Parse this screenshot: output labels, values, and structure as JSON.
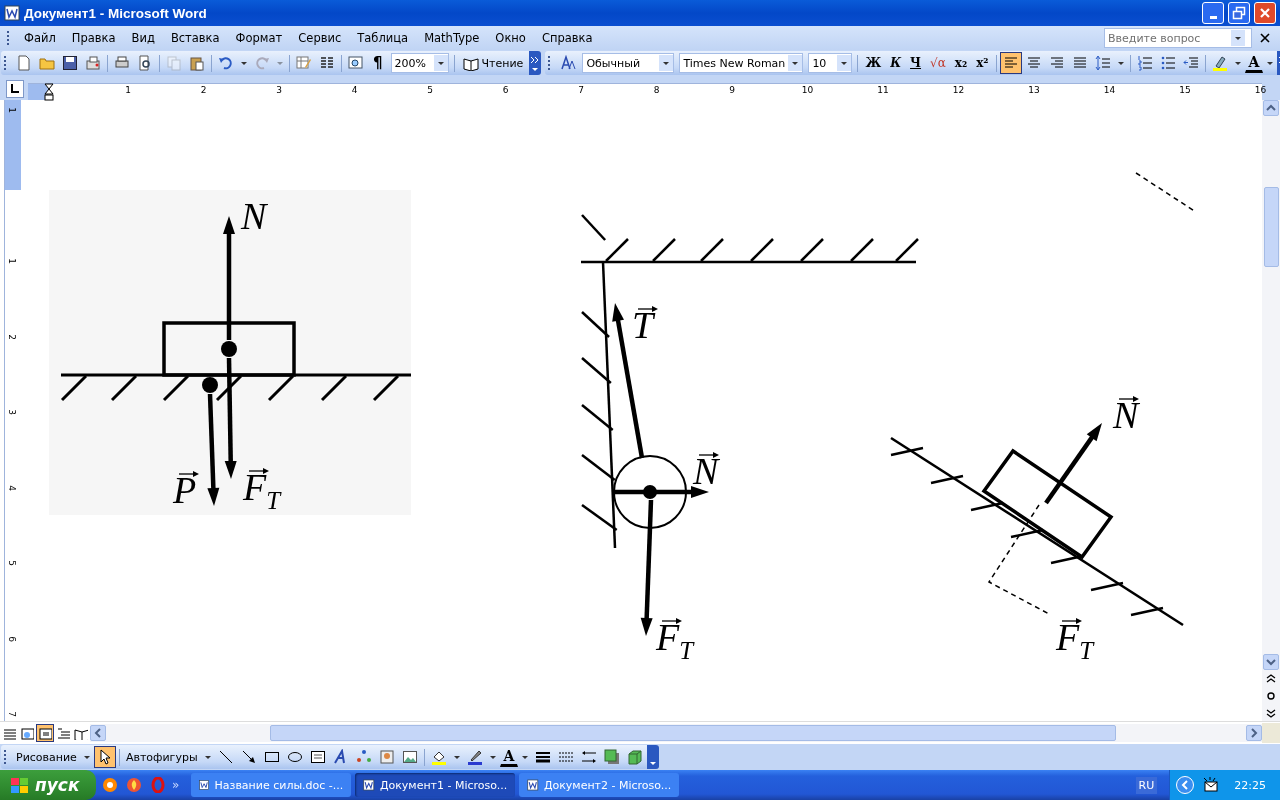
{
  "window": {
    "title": "Документ1 - Microsoft Word"
  },
  "menu": [
    "Файл",
    "Правка",
    "Вид",
    "Вставка",
    "Формат",
    "Сервис",
    "Таблица",
    "MathType",
    "Окно",
    "Справка"
  ],
  "help_box": {
    "placeholder": "Введите вопрос"
  },
  "standard_toolbar": {
    "pilcrow": "¶",
    "zoom": "200%",
    "reading": "Чтение"
  },
  "formatting_toolbar": {
    "style": "Обычный",
    "font": "Times New Roman",
    "size": "10",
    "text_buttons": [
      "Ж",
      "К",
      "Ч",
      "√α",
      "x₂",
      "x²"
    ],
    "font_color": "A",
    "align_buttons": [
      {
        "selected": true
      },
      {
        "selected": false
      },
      {
        "selected": false
      },
      {
        "selected": false
      }
    ]
  },
  "ruler": {
    "numbers": [
      "1",
      "2",
      "3",
      "4",
      "5",
      "6",
      "7",
      "8",
      "9",
      "10",
      "11",
      "12",
      "13",
      "14",
      "15",
      "16"
    ]
  },
  "vertical_ruler": {
    "numbers": [
      "1",
      "1",
      "2",
      "3",
      "4",
      "5",
      "6",
      "7"
    ]
  },
  "diagrams": [
    {
      "kind": "block-on-floor",
      "labels": [
        {
          "letter": "N",
          "vector": false
        },
        {
          "letter": "P",
          "vector": true
        },
        {
          "letter": "F",
          "subscript": "T",
          "vector": true
        }
      ]
    },
    {
      "kind": "ball-on-wall",
      "labels": [
        {
          "letter": "T",
          "vector": true
        },
        {
          "letter": "N",
          "vector": true
        },
        {
          "letter": "F",
          "subscript": "T",
          "vector": true
        }
      ]
    },
    {
      "kind": "block-on-incline",
      "labels": [
        {
          "letter": "N",
          "vector": true
        },
        {
          "letter": "F",
          "subscript": "T",
          "vector": true
        }
      ]
    }
  ],
  "view_buttons": [
    {
      "selected": false
    },
    {
      "selected": false
    },
    {
      "selected": true
    },
    {
      "selected": false
    },
    {
      "selected": false
    }
  ],
  "drawing_toolbar": {
    "menu": "Рисование",
    "pointer": {
      "selected": true
    },
    "autoshapes": "Автофигуры",
    "font_color": "A"
  },
  "taskbar": {
    "start": "пуск",
    "more": "»",
    "tasks": [
      {
        "label": "Название силы.doc -...",
        "selected": false
      },
      {
        "label": "Документ1 - Microso...",
        "selected": true
      },
      {
        "label": "Документ2 - Microso...",
        "selected": false
      }
    ],
    "language": "RU",
    "clock": "22:25"
  }
}
